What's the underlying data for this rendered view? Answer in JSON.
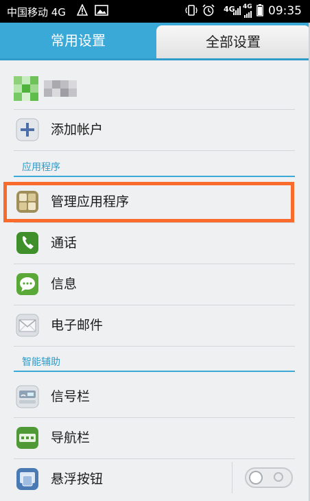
{
  "status_bar": {
    "carrier": "中国移动 4G",
    "network_1": "4G",
    "network_2": "4G",
    "time": "09:35"
  },
  "tabs": [
    {
      "label": "常用设置"
    },
    {
      "label": "全部设置"
    }
  ],
  "account": {
    "add_account": "添加帐户"
  },
  "sections": {
    "apps": "应用程序",
    "assist": "智能辅助"
  },
  "apps": [
    {
      "label": "管理应用程序",
      "icon": "app-grid-icon"
    },
    {
      "label": "通话",
      "icon": "phone-icon"
    },
    {
      "label": "信息",
      "icon": "message-icon"
    },
    {
      "label": "电子邮件",
      "icon": "email-icon"
    }
  ],
  "assist": [
    {
      "label": "信号栏",
      "icon": "signal-bar-icon"
    },
    {
      "label": "导航栏",
      "icon": "navigation-bar-icon"
    },
    {
      "label": "悬浮按钮",
      "icon": "floating-button-icon",
      "toggle": "off"
    }
  ],
  "colors": {
    "accent": "#3aa9d8",
    "highlight": "#f96b2d"
  }
}
